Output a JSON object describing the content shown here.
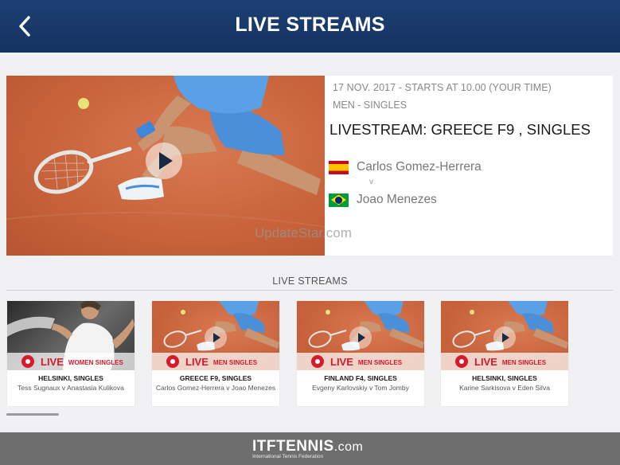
{
  "header": {
    "title": "LIVE STREAMS",
    "back_icon": "chevron-left-icon"
  },
  "featured": {
    "meta": "17 NOV. 2017 - STARTS AT 10.00 (YOUR TIME)",
    "category": "MEN - SINGLES",
    "title": "LIVESTREAM: GREECE F9 , SINGLES",
    "player1": {
      "name": "Carlos Gomez-Herrera",
      "flag": "spain-flag-icon"
    },
    "versus": "v",
    "player2": {
      "name": "Joao Menezes",
      "flag": "brazil-flag-icon"
    },
    "watermark": "UpdateStar.com"
  },
  "section": {
    "label": "LIVE STREAMS"
  },
  "cards": [
    {
      "live": "LIVE",
      "category": "WOMEN SINGLES",
      "title": "HELSINKI, SINGLES",
      "subtitle": "Tess Sugnaux v Anastasia Kulikova"
    },
    {
      "live": "LIVE",
      "category": "MEN SINGLES",
      "title": "GREECE F9, SINGLES",
      "subtitle": "Carlos Gomez-Herrera v Joao Menezes"
    },
    {
      "live": "LIVE",
      "category": "MEN SINGLES",
      "title": "FINLAND F4, SINGLES",
      "subtitle": "Evgeny Karlovskiy v Tom Jomby"
    },
    {
      "live": "LIVE",
      "category": "MEN SINGLES",
      "title": "HELSINKI, SINGLES",
      "subtitle": "Karine Sarkisova v Eden Silva"
    }
  ],
  "footer": {
    "logo_main": "ITFTENNIS",
    "logo_domain": ".com",
    "logo_tagline": "International Tennis Federation"
  },
  "colors": {
    "header": "#1d3f72",
    "live": "#d41a2b",
    "clay": "#c7623a",
    "footer": "#6e6e6e"
  }
}
